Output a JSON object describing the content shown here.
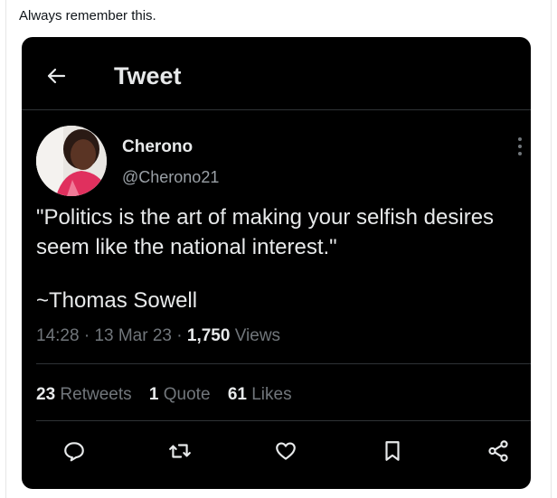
{
  "post": {
    "caption": "Always remember this."
  },
  "card": {
    "header": {
      "title": "Tweet",
      "back_icon": "arrow-left-icon"
    },
    "author": {
      "name": "Cherono",
      "handle": "@Cherono21",
      "avatar_icon": "profile-photo"
    },
    "text_lines": [
      "\"Politics is the art of making your selfish desires",
      "seem like the national interest.\""
    ],
    "attribution": "~Thomas Sowell",
    "meta": {
      "time": "14:28",
      "sep1": " · ",
      "date": "13 Mar 23",
      "sep2": " · ",
      "views_count": "1,750",
      "views_label": " Views"
    },
    "stats": {
      "retweets_count": "23",
      "retweets_label": "Retweets",
      "quotes_count": "1",
      "quotes_label": "Quote",
      "likes_count": "61",
      "likes_label": "Likes"
    },
    "actions": [
      "reply-icon",
      "retweet-icon",
      "like-icon",
      "bookmark-icon",
      "share-icon"
    ]
  },
  "colors": {
    "card_background": "#000000",
    "text_primary": "#e7e9ea",
    "text_secondary": "#71767b",
    "divider": "#2f3336"
  }
}
